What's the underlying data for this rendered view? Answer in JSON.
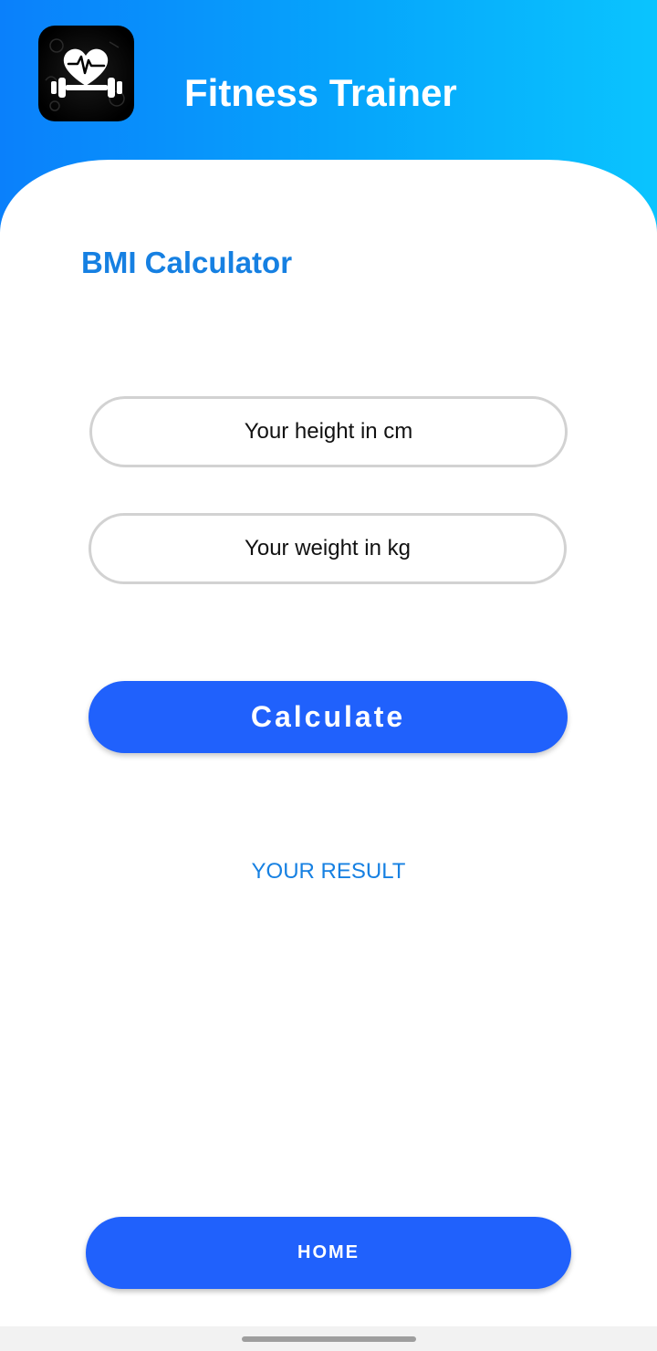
{
  "header": {
    "app_title": "Fitness Trainer",
    "logo_icon": "heart-dumbbell-icon",
    "gradient_colors": [
      "#0a80fb",
      "#0ac4fe"
    ]
  },
  "main": {
    "page_title": "BMI Calculator",
    "height_input": {
      "placeholder": "Your height in cm",
      "value": ""
    },
    "weight_input": {
      "placeholder": "Your weight in kg",
      "value": ""
    },
    "calculate_label": "Calculate",
    "result_label": "YOUR RESULT"
  },
  "footer": {
    "home_label": "HOME"
  },
  "colors": {
    "accent_text": "#1680e2",
    "button": "#2061fc"
  }
}
